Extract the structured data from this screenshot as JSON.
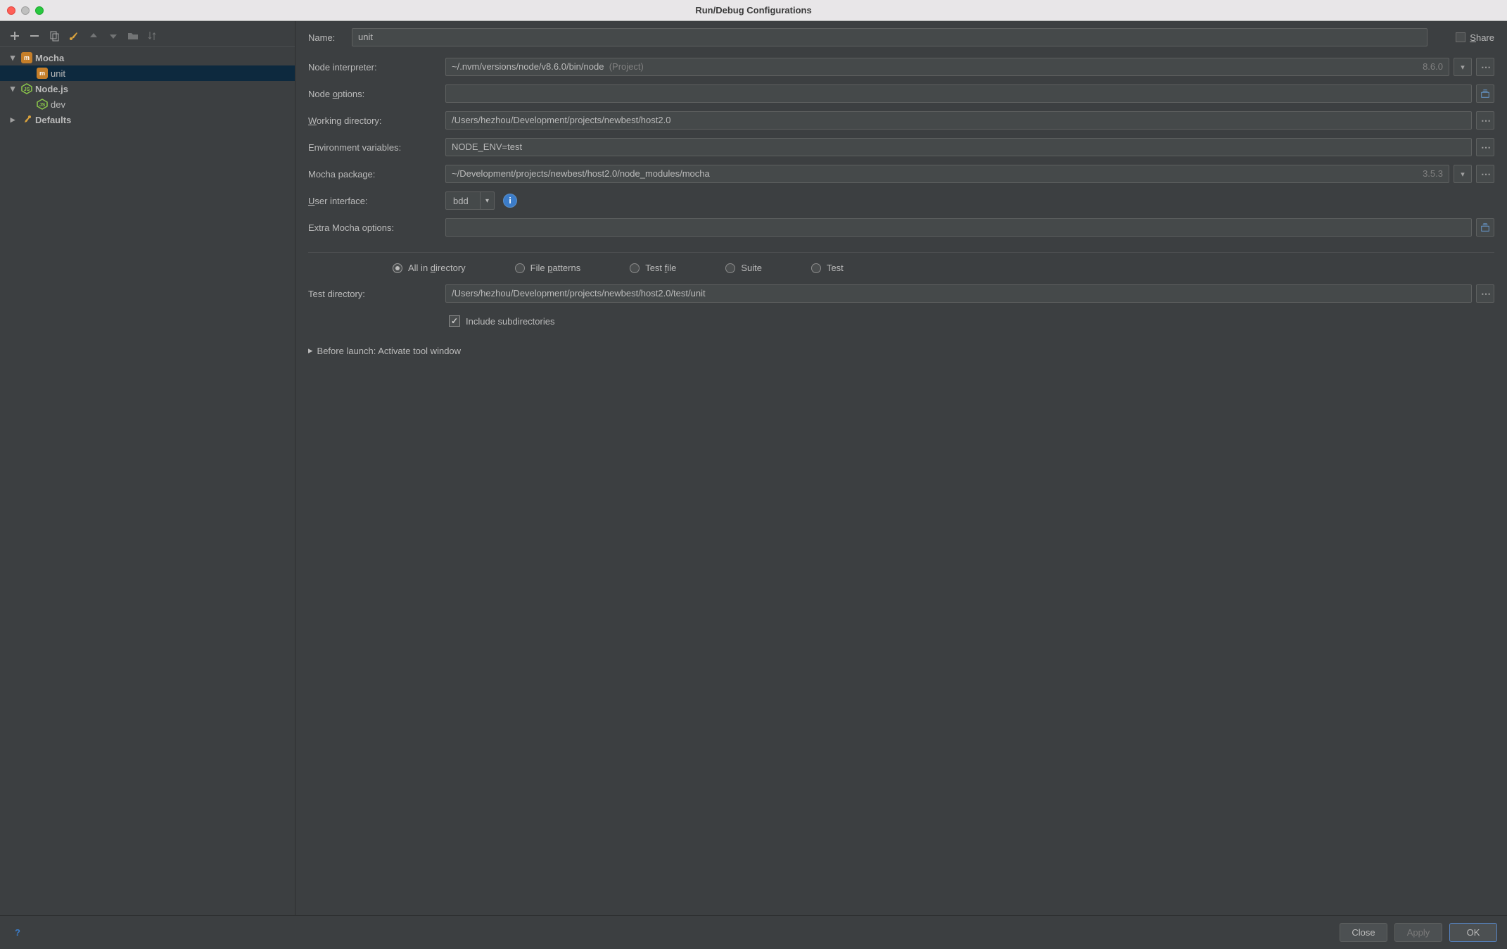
{
  "window": {
    "title": "Run/Debug Configurations"
  },
  "tree": {
    "groups": [
      {
        "id": "mocha",
        "label": "Mocha",
        "icon": "mocha",
        "expanded": true,
        "children": [
          {
            "id": "unit",
            "label": "unit",
            "icon": "mocha",
            "selected": true
          }
        ]
      },
      {
        "id": "nodejs",
        "label": "Node.js",
        "icon": "node",
        "expanded": true,
        "children": [
          {
            "id": "dev",
            "label": "dev",
            "icon": "node",
            "selected": false
          }
        ]
      },
      {
        "id": "defaults",
        "label": "Defaults",
        "icon": "wrench",
        "expanded": false,
        "children": []
      }
    ]
  },
  "header": {
    "name_label": "Name:",
    "name_value": "unit",
    "share_label": "Share"
  },
  "form": {
    "fields": {
      "node_interpreter": {
        "label": "Node interpreter:",
        "value": "~/.nvm/versions/node/v8.6.0/bin/node",
        "suffix": "(Project)",
        "version": "8.6.0"
      },
      "node_options": {
        "label": "Node options:",
        "value": ""
      },
      "working_dir": {
        "label": "Working directory:",
        "value": "/Users/hezhou/Development/projects/newbest/host2.0"
      },
      "env_vars": {
        "label": "Environment variables:",
        "value": "NODE_ENV=test"
      },
      "mocha_package": {
        "label": "Mocha package:",
        "value": "~/Development/projects/newbest/host2.0/node_modules/mocha",
        "version": "3.5.3"
      },
      "user_interface": {
        "label": "User interface:",
        "value": "bdd"
      },
      "extra_mocha": {
        "label": "Extra Mocha options:",
        "value": ""
      }
    },
    "scope": {
      "options": [
        {
          "label_pre": "All in ",
          "label_u": "d",
          "label_post": "irectory",
          "selected": true
        },
        {
          "label_pre": "File ",
          "label_u": "p",
          "label_post": "atterns",
          "selected": false
        },
        {
          "label_pre": "Test ",
          "label_u": "f",
          "label_post": "ile",
          "selected": false
        },
        {
          "label_pre": "",
          "label_u": "",
          "label_post": "Suite",
          "selected": false
        },
        {
          "label_pre": "",
          "label_u": "",
          "label_post": "Test",
          "selected": false
        }
      ]
    },
    "test_dir": {
      "label": "Test directory:",
      "value": "/Users/hezhou/Development/projects/newbest/host2.0/test/unit"
    },
    "include_sub": {
      "label": "Include subdirectories",
      "checked": true
    },
    "before_launch": {
      "label": "Before launch: Activate tool window",
      "expanded": false
    }
  },
  "footer": {
    "close": "Close",
    "apply": "Apply",
    "ok": "OK"
  }
}
